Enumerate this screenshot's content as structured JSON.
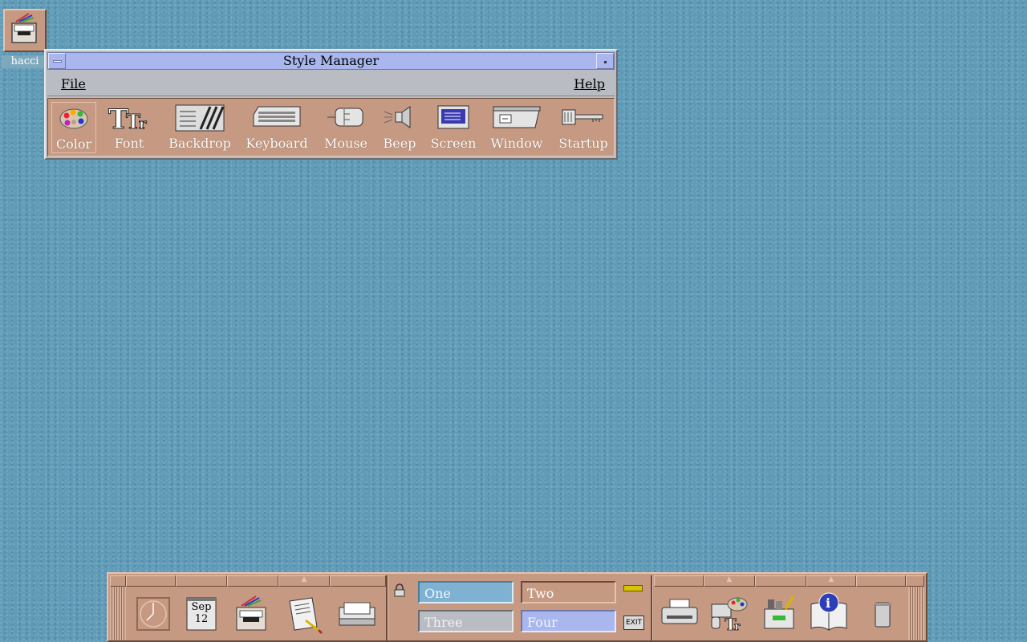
{
  "desktop": {
    "icon_label": "hacci"
  },
  "window": {
    "title": "Style Manager",
    "menu": {
      "file": "File",
      "help": "Help"
    },
    "tools": [
      {
        "label": "Color",
        "icon": "palette-icon"
      },
      {
        "label": "Font",
        "icon": "font-icon"
      },
      {
        "label": "Backdrop",
        "icon": "backdrop-icon"
      },
      {
        "label": "Keyboard",
        "icon": "keyboard-icon"
      },
      {
        "label": "Mouse",
        "icon": "mouse-icon"
      },
      {
        "label": "Beep",
        "icon": "speaker-icon"
      },
      {
        "label": "Screen",
        "icon": "monitor-icon"
      },
      {
        "label": "Window",
        "icon": "window-icon"
      },
      {
        "label": "Startup",
        "icon": "key-icon"
      }
    ]
  },
  "front_panel": {
    "date_month": "Sep",
    "date_day": "12",
    "workspaces": [
      "One",
      "Two",
      "Three",
      "Four"
    ],
    "exit_label": "EXIT"
  },
  "colors": {
    "desktop_bg": "#5f9bb7",
    "panel_tan": "#c69a82",
    "window_grey": "#b9bcc2",
    "title_lavender": "#aab7ee"
  }
}
